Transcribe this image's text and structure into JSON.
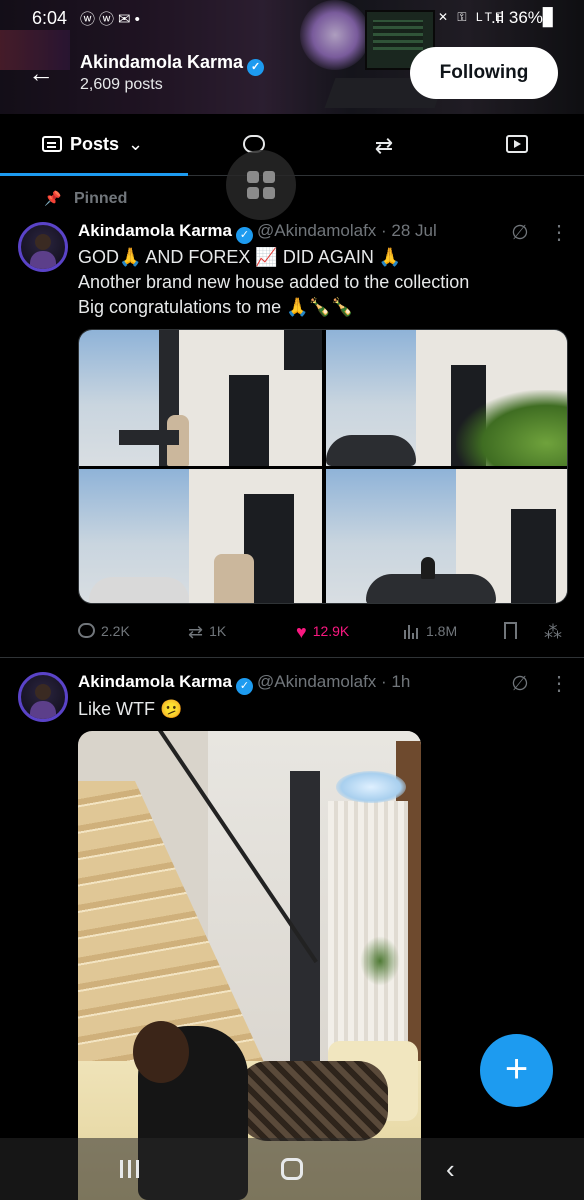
{
  "status_bar": {
    "time": "6:04",
    "left_icons": "ⓦⓦ✉•",
    "right_icons": "✕ ⚿ LTE",
    "battery": ".ıl 36%▊"
  },
  "header": {
    "name": "Akindamola Karma",
    "post_count": "2,609 posts",
    "follow_label": "Following",
    "back_icon": "←"
  },
  "tabs": {
    "posts_label": "Posts",
    "posts_chevron": "⌄",
    "retweet_icon": "⇄"
  },
  "posts": [
    {
      "pinned_label": "Pinned",
      "name": "Akindamola Karma",
      "handle": "@Akindamolafx · 28 Jul",
      "text": "GOD🙏 AND FOREX 📈 DID AGAIN 🙏\nAnother brand new house added to the collection\nBig congratulations to me 🙏🍾🍾",
      "replies": "2.2K",
      "reposts": "1K",
      "likes": "12.9K",
      "views": "1.8M"
    },
    {
      "name": "Akindamola Karma",
      "handle": "@Akindamolafx · 1h",
      "text": "Like WTF 🫤"
    }
  ],
  "icons": {
    "grok": "∅",
    "more": "⋮",
    "pin": "📌",
    "heart": "♥",
    "share": "⁂",
    "plus": "+",
    "back_nav": "‹"
  },
  "colors": {
    "accent": "#1d9bf0",
    "like": "#f91880",
    "muted": "#71767b"
  }
}
